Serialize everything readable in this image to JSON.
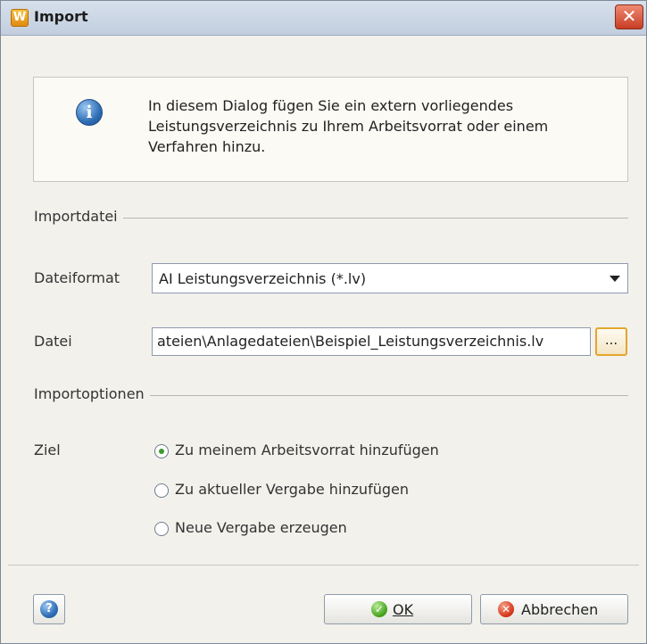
{
  "window": {
    "title": "Import",
    "app_icon": "W"
  },
  "info": {
    "icon": "info-icon",
    "text": "In diesem Dialog fügen Sie ein extern vorliegendes Leistungsverzeichnis zu Ihrem Arbeitsvorrat oder einem Verfahren hinzu."
  },
  "import_file": {
    "section_label": "Importdatei",
    "format_label": "Dateiformat",
    "format_value": "AI Leistungsverzeichnis (*.lv)",
    "file_label": "Datei",
    "file_value": "ateien\\Anlagedateien\\Beispiel_Leistungsverzeichnis.lv",
    "browse_label": "..."
  },
  "import_options": {
    "section_label": "Importoptionen",
    "target_label": "Ziel",
    "options": [
      {
        "label": "Zu meinem Arbeitsvorrat hinzufügen",
        "selected": true
      },
      {
        "label": "Zu aktueller Vergabe hinzufügen",
        "selected": false
      },
      {
        "label": "Neue Vergabe erzeugen",
        "selected": false
      }
    ]
  },
  "footer": {
    "ok_label": "OK",
    "cancel_label": "Abbrechen",
    "help_icon": "help-icon"
  },
  "colors": {
    "accent": "#e3a62b",
    "ok_green": "#4aa51f",
    "cancel_red": "#d9391d",
    "info_blue": "#2f6eb6"
  }
}
